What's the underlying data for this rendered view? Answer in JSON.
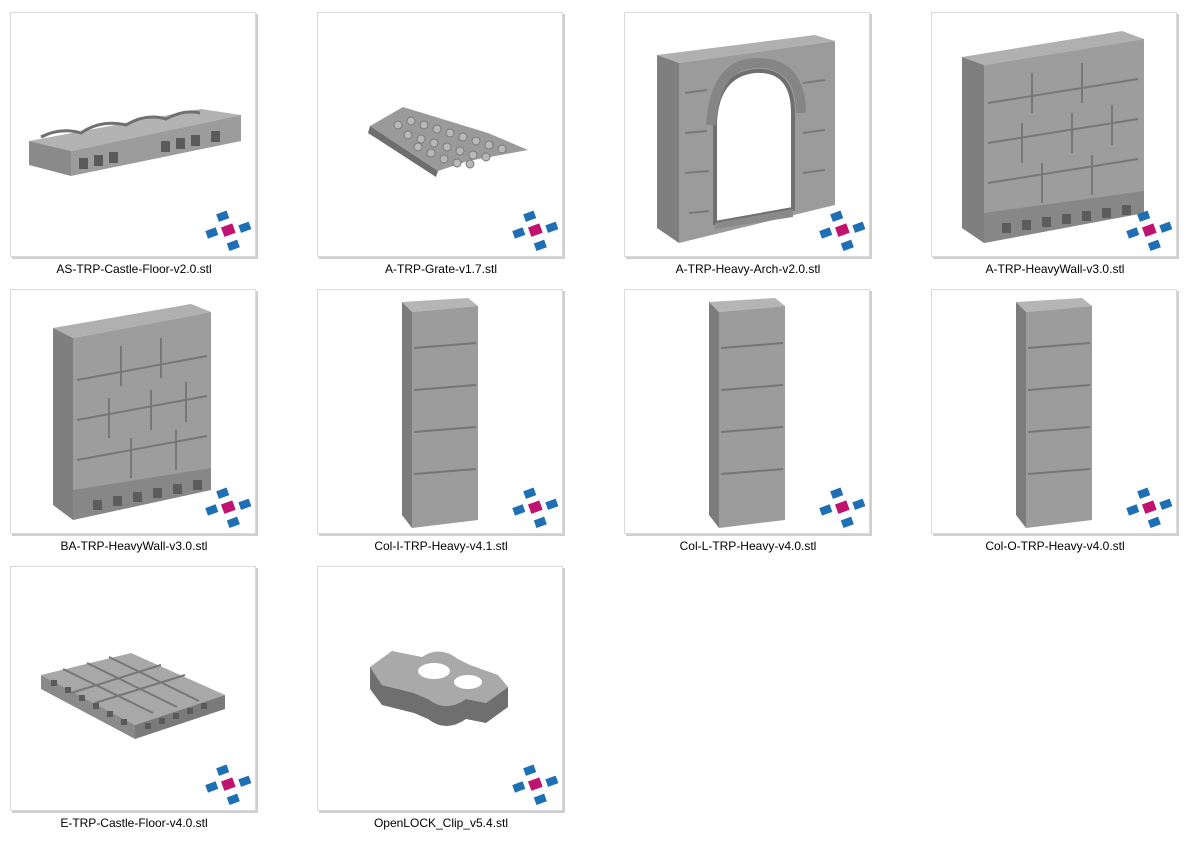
{
  "files": [
    {
      "name": "AS-TRP-Castle-Floor-v2.0.stl",
      "icon": "castle-floor-strip-model"
    },
    {
      "name": "A-TRP-Grate-v1.7.stl",
      "icon": "grate-model"
    },
    {
      "name": "A-TRP-Heavy-Arch-v2.0.stl",
      "icon": "heavy-arch-model"
    },
    {
      "name": "A-TRP-HeavyWall-v3.0.stl",
      "icon": "heavy-wall-model"
    },
    {
      "name": "BA-TRP-HeavyWall-v3.0.stl",
      "icon": "heavy-wall-model"
    },
    {
      "name": "Col-I-TRP-Heavy-v4.1.stl",
      "icon": "column-model"
    },
    {
      "name": "Col-L-TRP-Heavy-v4.0.stl",
      "icon": "column-model"
    },
    {
      "name": "Col-O-TRP-Heavy-v4.0.stl",
      "icon": "column-model"
    },
    {
      "name": "E-TRP-Castle-Floor-v4.0.stl",
      "icon": "castle-floor-tile-model"
    },
    {
      "name": "OpenLOCK_Clip_v5.4.stl",
      "icon": "clip-model"
    }
  ],
  "colors": {
    "badge_blue": "#1e6fb3",
    "badge_magenta": "#c0136f",
    "model_gray": "#8f8f8f"
  }
}
